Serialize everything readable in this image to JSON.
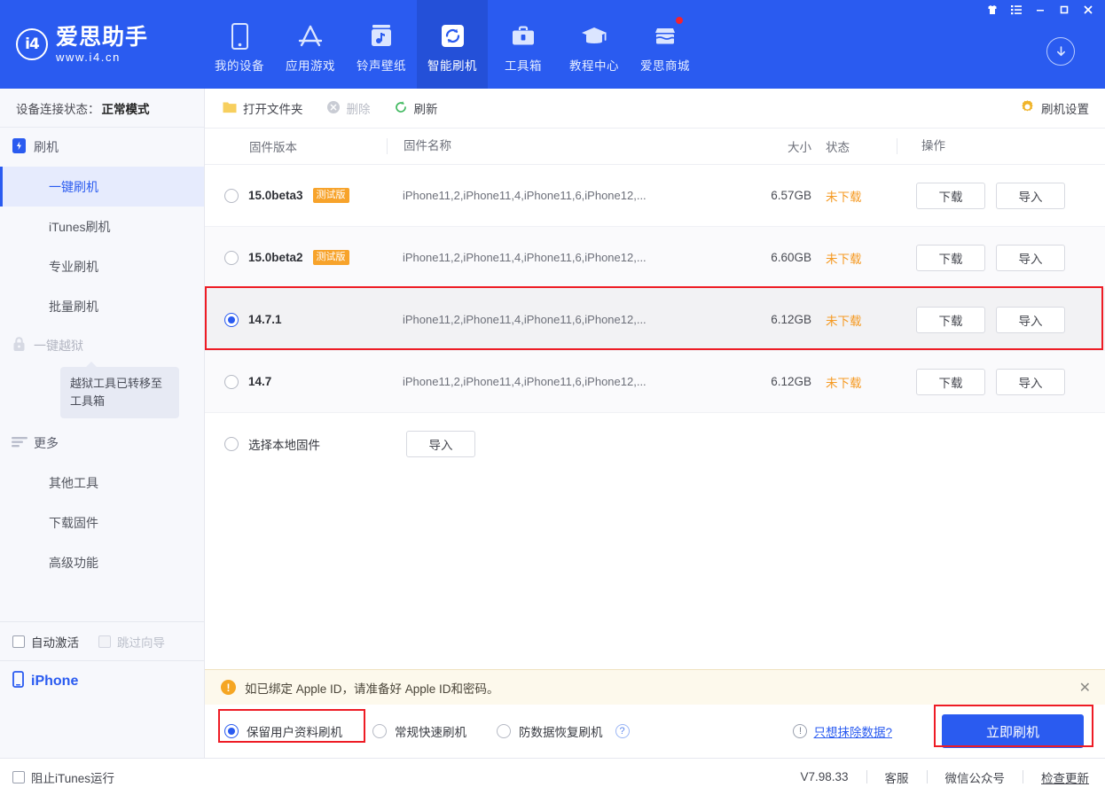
{
  "header": {
    "logo_name": "爱思助手",
    "logo_url": "www.i4.cn",
    "logo_mark": "i4",
    "nav": [
      {
        "label": "我的设备",
        "icon": "phone-icon",
        "active": false
      },
      {
        "label": "应用游戏",
        "icon": "appstore-icon",
        "active": false
      },
      {
        "label": "铃声壁纸",
        "icon": "music-icon",
        "active": false
      },
      {
        "label": "智能刷机",
        "icon": "refresh-icon",
        "active": true
      },
      {
        "label": "工具箱",
        "icon": "toolbox-icon",
        "active": false
      },
      {
        "label": "教程中心",
        "icon": "graduation-cap-icon",
        "active": false
      },
      {
        "label": "爱思商城",
        "icon": "store-icon",
        "active": false,
        "badge": true
      }
    ],
    "window_controls": [
      "shirt-icon",
      "list-icon",
      "minimize-icon",
      "maximize-icon",
      "close-icon"
    ],
    "download_icon": "download-arrow-icon"
  },
  "sidebar": {
    "connection_label": "设备连接状态：",
    "connection_value": "正常模式",
    "group_flash": {
      "label": "刷机",
      "icon": "flash-phone-icon"
    },
    "items": [
      {
        "label": "一键刷机",
        "active": true
      },
      {
        "label": "iTunes刷机",
        "active": false
      },
      {
        "label": "专业刷机",
        "active": false
      },
      {
        "label": "批量刷机",
        "active": false
      }
    ],
    "group_jailbreak": {
      "label": "一键越狱",
      "icon": "lock-icon"
    },
    "tooltip": "越狱工具已转移至工具箱",
    "group_more": {
      "label": "更多",
      "icon": "menu-lines-icon"
    },
    "more_items": [
      {
        "label": "其他工具"
      },
      {
        "label": "下载固件"
      },
      {
        "label": "高级功能"
      }
    ],
    "checkboxes": [
      {
        "label": "自动激活",
        "checked": false,
        "disabled": false
      },
      {
        "label": "跳过向导",
        "checked": false,
        "disabled": true
      }
    ],
    "device": {
      "label": "iPhone",
      "icon": "phone-icon"
    }
  },
  "toolbar": {
    "open_folder": "打开文件夹",
    "delete": "删除",
    "refresh": "刷新",
    "settings": "刷机设置"
  },
  "table": {
    "columns": [
      "固件版本",
      "固件名称",
      "大小",
      "状态",
      "操作"
    ],
    "rows": [
      {
        "version": "15.0beta3",
        "badge": "测试版",
        "name": "iPhone11,2,iPhone11,4,iPhone11,6,iPhone12,...",
        "size": "6.57GB",
        "state": "未下载",
        "selected": false,
        "actions": [
          "下载",
          "导入"
        ]
      },
      {
        "version": "15.0beta2",
        "badge": "测试版",
        "name": "iPhone11,2,iPhone11,4,iPhone11,6,iPhone12,...",
        "size": "6.60GB",
        "state": "未下载",
        "selected": false,
        "actions": [
          "下载",
          "导入"
        ]
      },
      {
        "version": "14.7.1",
        "badge": "",
        "name": "iPhone11,2,iPhone11,4,iPhone11,6,iPhone12,...",
        "size": "6.12GB",
        "state": "未下载",
        "selected": true,
        "highlighted": true,
        "actions": [
          "下载",
          "导入"
        ]
      },
      {
        "version": "14.7",
        "badge": "",
        "name": "iPhone11,2,iPhone11,4,iPhone11,6,iPhone12,...",
        "size": "6.12GB",
        "state": "未下载",
        "selected": false,
        "actions": [
          "下载",
          "导入"
        ]
      },
      {
        "version": "选择本地固件",
        "badge": "",
        "name": "",
        "size": "",
        "state": "",
        "selected": false,
        "local": true,
        "actions": [
          "导入"
        ]
      }
    ]
  },
  "notice": {
    "text": "如已绑定 Apple ID，请准备好 Apple ID和密码。",
    "icon": "warning-icon",
    "close": "✕"
  },
  "options": {
    "modes": [
      {
        "label": "保留用户资料刷机",
        "selected": true,
        "highlighted": true
      },
      {
        "label": "常规快速刷机",
        "selected": false
      },
      {
        "label": "防数据恢复刷机",
        "selected": false,
        "help": "?"
      }
    ],
    "erase_link": "只想抹除数据?",
    "flash_button": "立即刷机"
  },
  "status_bar": {
    "block_itunes": "阻止iTunes运行",
    "version": "V7.98.33",
    "links": [
      "客服",
      "微信公众号",
      "检查更新"
    ]
  },
  "colors": {
    "brand_blue": "#2a5bf0",
    "active_nav": "#2450d8",
    "highlight_red": "#ee1c25",
    "state_orange": "#f59a23",
    "badge_orange": "#f7a32b",
    "notice_bg": "#fdf9ec"
  }
}
